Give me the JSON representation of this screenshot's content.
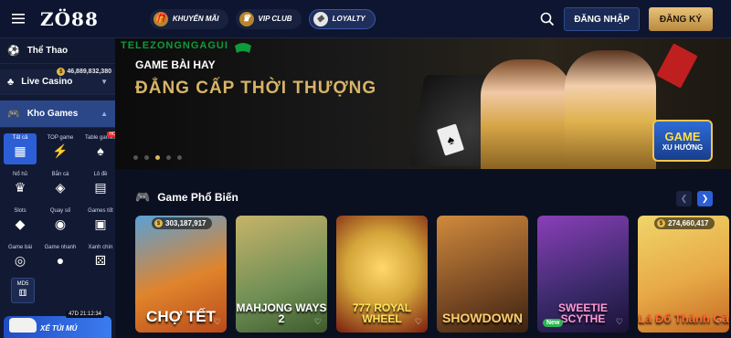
{
  "header": {
    "logo": "ZÖ88",
    "promos": [
      {
        "label": "KHUYẾN MÃI",
        "icon": "gift-icon"
      },
      {
        "label": "VIP CLUB",
        "icon": "crown-icon"
      },
      {
        "label": "LOYALTY",
        "icon": "diamond-icon"
      }
    ],
    "login_label": "ĐĂNG NHẬP",
    "register_label": "ĐĂNG KÝ"
  },
  "sidebar": {
    "items": [
      {
        "label": "Thể Thao",
        "icon": "soccer-ball-icon"
      },
      {
        "label": "Live Casino",
        "icon": "cards-icon",
        "balance": "46,889,832,380"
      },
      {
        "label": "Kho Games",
        "icon": "gamepad-icon"
      }
    ],
    "game_categories": [
      {
        "label": "Tất cả",
        "icon": "grid-icon",
        "glyph": "▦"
      },
      {
        "label": "TOP game",
        "icon": "lightning-icon",
        "glyph": "⚡"
      },
      {
        "label": "Table games",
        "icon": "table-cards-icon",
        "glyph": "♠",
        "hot": "HOT"
      },
      {
        "label": "Nổ hũ",
        "icon": "slot-pot-icon",
        "glyph": "♛"
      },
      {
        "label": "Bắn cá",
        "icon": "fish-icon",
        "glyph": "◈"
      },
      {
        "label": "Lô đề",
        "icon": "lottery-icon",
        "glyph": "▤"
      },
      {
        "label": "Slots",
        "icon": "diamond-icon",
        "glyph": "◆"
      },
      {
        "label": "Quay số",
        "icon": "lottery-ball-icon",
        "glyph": "◉"
      },
      {
        "label": "Games tốt",
        "icon": "slot-machine-icon",
        "glyph": "▣"
      },
      {
        "label": "Game bài",
        "icon": "poker-chip-icon",
        "glyph": "◎"
      },
      {
        "label": "Game nhanh",
        "icon": "bomb-icon",
        "glyph": "●"
      },
      {
        "label": "Xanh chín",
        "icon": "dice-icon",
        "glyph": "⚄"
      }
    ],
    "mds_label": "MD5",
    "car_promo": {
      "title": "XẾ TÚI MÚ",
      "timer": "47D 21:12:34"
    }
  },
  "banner": {
    "watermark": "TELEZONGNGAGUI",
    "title_line1": "GAME BÀI HAY",
    "title_line2": "ĐẲNG CẤP THỜI THƯỢNG",
    "badge_line1": "GAME",
    "badge_line2": "XU HƯỚNG",
    "active_slide_index": 2,
    "slide_count": 5
  },
  "section": {
    "title": "Game Phổ Biến",
    "icon": "gamepad-icon"
  },
  "games": [
    {
      "title": "CHỢ TẾT",
      "jackpot": "303,187,917",
      "bg": "#e0842c",
      "bg2": "#5aa0d6",
      "tcolor": "#ffffff"
    },
    {
      "title": "MAHJONG WAYS 2",
      "bg": "#6f8f55",
      "bg2": "#c7b36a",
      "tcolor": "#ffffff"
    },
    {
      "title": "777 ROYAL WHEEL",
      "bg": "#d4a63a",
      "bg2": "#7a1d10",
      "tcolor": "#ffe259"
    },
    {
      "title": "SHOWDOWN",
      "bg": "#7a4a24",
      "bg2": "#d08a3c",
      "tcolor": "#ffcf6b"
    },
    {
      "title": "SWEETIE SCYTHE",
      "bg": "#3b2a6b",
      "bg2": "#8a3fb8",
      "tcolor": "#ff9ad8",
      "new": "New"
    },
    {
      "title": "Lá Đổ Thành Gà",
      "jackpot": "274,660,417",
      "bg": "#e7a947",
      "bg2": "#f0d56a",
      "tcolor": "#ff6a2a"
    }
  ]
}
